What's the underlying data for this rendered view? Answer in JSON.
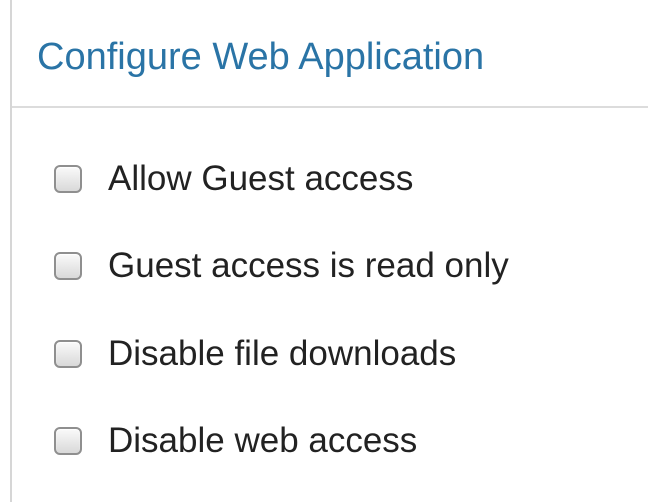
{
  "panel": {
    "title": "Configure Web Application",
    "title_color": "#2a74a6"
  },
  "options": [
    {
      "label": "Allow Guest access",
      "checked": false
    },
    {
      "label": "Guest access is read only",
      "checked": false
    },
    {
      "label": "Disable file downloads",
      "checked": false
    },
    {
      "label": "Disable web access",
      "checked": false
    }
  ]
}
